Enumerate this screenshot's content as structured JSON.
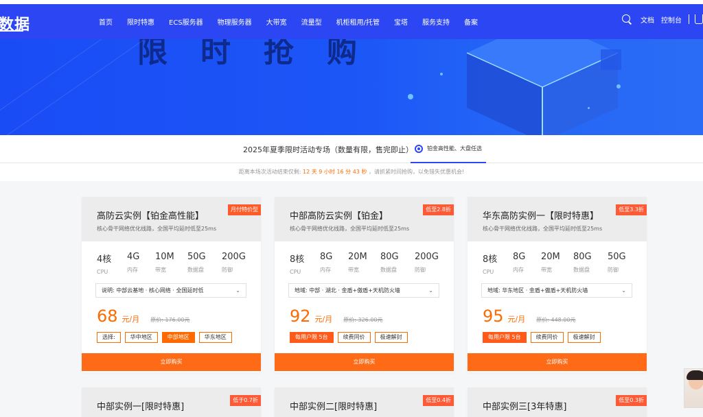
{
  "nav": {
    "logo": "数据",
    "links": [
      "首页",
      "限时特惠",
      "ECS服务器",
      "物理服务器",
      "大带宽",
      "流量型",
      "机柜租用/托管",
      "宝塔",
      "服务支持",
      "备案"
    ],
    "right": {
      "docs": "文档",
      "console": "控制台"
    }
  },
  "banner": {
    "title": "限时抢购"
  },
  "tabs": {
    "main": "2025年夏季限时活动专场（数量有限，售完即止）",
    "active": "铂金高性能、大盘任选"
  },
  "countdown": {
    "prefix": "距离本场次活动结束仅剩:",
    "time": "12 天 9 小时 16 分 43 秒",
    "suffix": "，请抓紧时间抢购，以免错失优惠机会!"
  },
  "cards": [
    {
      "title": "高防云实例【铂金高性能】",
      "sub": "核心骨干网络优化线路，全国平均延时低至25ms",
      "badge": "月付特价型",
      "specs": [
        {
          "v": "4核",
          "l": "CPU"
        },
        {
          "v": "4G",
          "l": "内存"
        },
        {
          "v": "10M",
          "l": "带宽"
        },
        {
          "v": "50G",
          "l": "数据盘"
        },
        {
          "v": "200G",
          "l": "防御"
        }
      ],
      "select": "说明:  中部云基地 · 核心网络 · 全国延时低",
      "price": "68",
      "unit": "元/月",
      "orig": "原价: 176.00元",
      "options": [
        "选择:",
        "华中地区",
        "中部地区",
        "华东地区"
      ],
      "buy": "立即购买"
    },
    {
      "title": "中部高防云实例【铂金】",
      "sub": "核心骨干网络优化线路，全国平均延时低至25ms",
      "badge": "低至2.8折",
      "specs": [
        {
          "v": "8核",
          "l": "CPU"
        },
        {
          "v": "8G",
          "l": "内存"
        },
        {
          "v": "20M",
          "l": "带宽"
        },
        {
          "v": "80G",
          "l": "数据盘"
        },
        {
          "v": "200G",
          "l": "防御"
        }
      ],
      "select": "地域:  中部 · 湖北 · 金盾+傲盾+天机防火墙",
      "price": "92",
      "unit": "元/月",
      "orig": "原价: 326.00元",
      "options": [
        "每用户限 5台",
        "续费同价",
        "极速解封"
      ],
      "buy": "立即购买"
    },
    {
      "title": "华东高防实例一【限时特惠】",
      "sub": "核心骨干网络优化线路，全国平均延时低至25ms",
      "badge": "低至3.3折",
      "specs": [
        {
          "v": "8核",
          "l": "CPU"
        },
        {
          "v": "8G",
          "l": "内存"
        },
        {
          "v": "20M",
          "l": "带宽"
        },
        {
          "v": "80G",
          "l": "数据盘"
        },
        {
          "v": "50G",
          "l": "防御"
        }
      ],
      "select": "地域:  华东地区 · 金盾+傲盾+天机防火墙",
      "price": "95",
      "unit": "元/月",
      "orig": "原价: 448.00元",
      "options": [
        "每用户限 5台",
        "续费同价",
        "极速解封"
      ],
      "buy": "立即购买"
    }
  ],
  "cards_row2": [
    {
      "title": "中部实例一[限时特惠]",
      "badge": "低于0.7折"
    },
    {
      "title": "中部实例二[限时特惠]",
      "badge": "低至0.4折"
    },
    {
      "title": "中部实例三[3年特惠]",
      "badge": "低至0.3折"
    }
  ],
  "colors": {
    "nav": "#2b46f2",
    "accent": "#ff6a00",
    "badge": "#ff5a36"
  }
}
